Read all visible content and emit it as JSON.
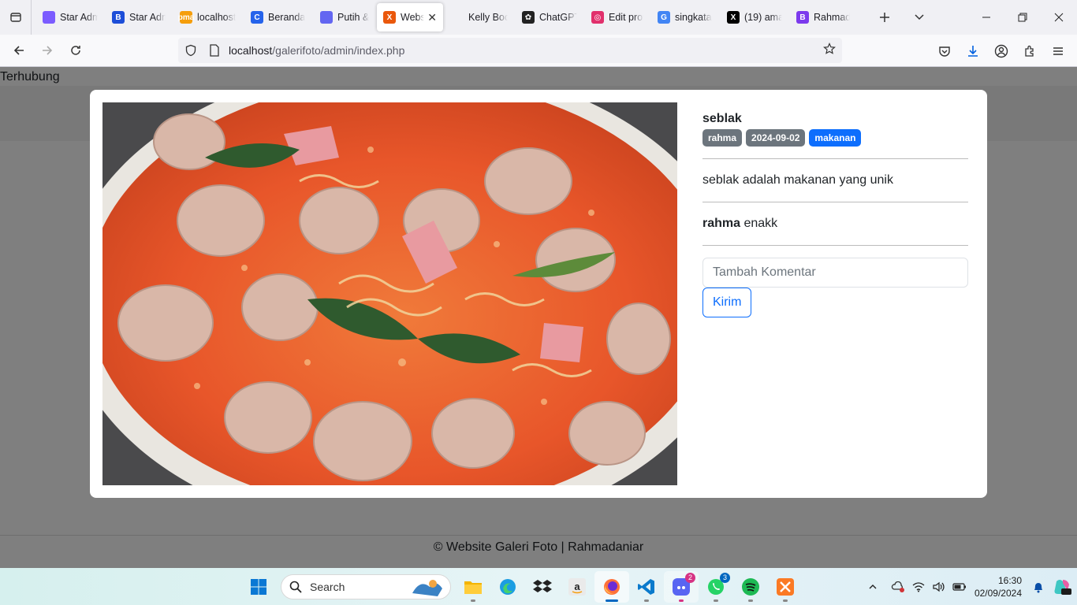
{
  "browser": {
    "tabs": [
      {
        "title": "Star Adm",
        "fav_color": "#7b5cff",
        "fav_text": ""
      },
      {
        "title": "Star Adm",
        "fav_color": "#1d4ed8",
        "fav_text": "B"
      },
      {
        "title": "localhost",
        "fav_color": "#f59e0b",
        "fav_text": "pma"
      },
      {
        "title": "Beranda",
        "fav_color": "#2563eb",
        "fav_text": "C"
      },
      {
        "title": "Putih &",
        "fav_color": "#6366f1",
        "fav_text": ""
      },
      {
        "title": "Websi",
        "fav_color": "#ea580c",
        "fav_text": "X",
        "active": true
      },
      {
        "title": "Kelly Bootstr",
        "fav_color": "",
        "fav_text": ""
      },
      {
        "title": "ChatGPT",
        "fav_color": "#222222",
        "fav_text": "✿"
      },
      {
        "title": "Edit prof",
        "fav_color": "#e1306c",
        "fav_text": "◎"
      },
      {
        "title": "singkata",
        "fav_color": "#4285f4",
        "fav_text": "G"
      },
      {
        "title": "(19) ama",
        "fav_color": "#000000",
        "fav_text": "X"
      },
      {
        "title": "Rahmad",
        "fav_color": "#7c3aed",
        "fav_text": "B"
      }
    ],
    "url_host": "localhost",
    "url_path": "/galerifoto/admin/index.php"
  },
  "page": {
    "status_text": "Terhubung",
    "footer_text": "© Website Galeri Foto | Rahmadaniar"
  },
  "modal": {
    "photo_alt": "seblak",
    "title": "seblak",
    "badges": [
      {
        "label": "rahma",
        "variant": "secondary"
      },
      {
        "label": "2024-09-02",
        "variant": "secondary"
      },
      {
        "label": "makanan",
        "variant": "primary"
      }
    ],
    "description": "seblak adalah makanan yang unik",
    "comments": [
      {
        "user": "rahma",
        "text": "enakk"
      }
    ],
    "comment_placeholder": "Tambah Komentar",
    "submit_label": "Kirim"
  },
  "taskbar": {
    "search_label": "Search",
    "time": "16:30",
    "date": "02/09/2024",
    "discord_badge": "2",
    "whatsapp_badge": "3"
  },
  "colors": {
    "primary": "#0d6efd",
    "secondary": "#6c757d"
  }
}
